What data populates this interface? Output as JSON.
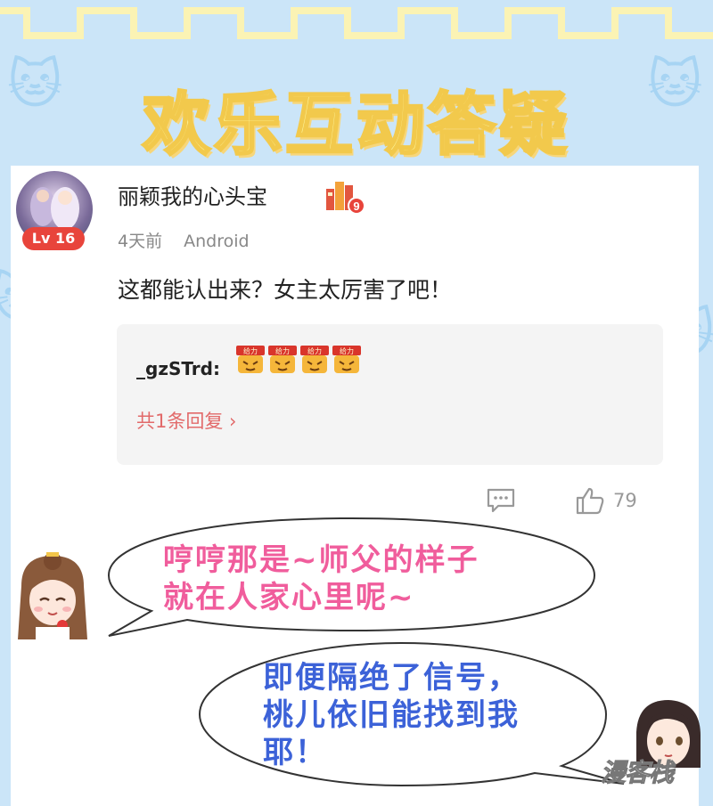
{
  "header": {
    "title": "欢乐互动答疑"
  },
  "comment": {
    "username": "丽颖我的心头宝",
    "level_badge": "Lv 16",
    "medal_number": "9",
    "time": "4天前",
    "device": "Android",
    "text": "这都能认出来？女主太厉害了吧！",
    "reply": {
      "user": "_gzSTrd:",
      "sticker_label": "给力",
      "sticker_count": 4,
      "count_text": "共1条回复"
    },
    "likes": "79"
  },
  "bubbles": {
    "first_line1": "哼哼那是~师父的样子",
    "first_line2": "就在人家心里呢~",
    "second_line1": "即便隔绝了信号，",
    "second_line2": "桃儿依旧能找到我",
    "second_line3": "耶！"
  },
  "watermark": "漫客栈",
  "colors": {
    "accent_pink": "#f05d9c",
    "accent_blue": "#3c62d8",
    "level_red": "#e8443b",
    "title_yellow": "#fdf49a"
  },
  "icons": [
    "comment-icon",
    "thumbs-up-icon",
    "chevron-right-icon",
    "medal-icon"
  ]
}
